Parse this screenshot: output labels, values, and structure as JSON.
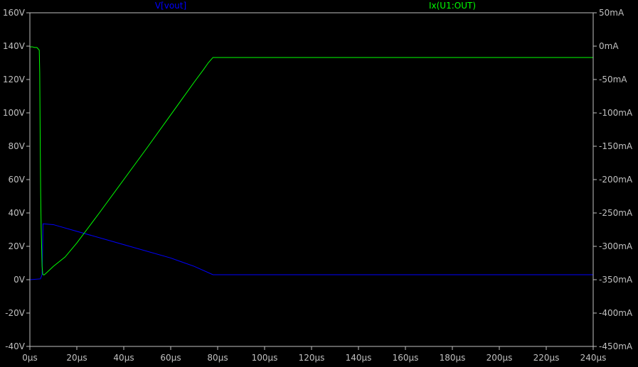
{
  "chart_data": {
    "type": "line",
    "title": "",
    "background": "#000000",
    "frame_color": "#c0c0c0",
    "grid": false,
    "x_axis": {
      "range_us": [
        0,
        240
      ],
      "tick_values_us": [
        0,
        20,
        40,
        60,
        80,
        100,
        120,
        140,
        160,
        180,
        200,
        220,
        240
      ],
      "tick_labels": [
        "0µs",
        "20µs",
        "40µs",
        "60µs",
        "80µs",
        "100µs",
        "120µs",
        "140µs",
        "160µs",
        "180µs",
        "200µs",
        "220µs",
        "240µs"
      ]
    },
    "left_axis": {
      "range_V": [
        -40,
        160
      ],
      "tick_values_V": [
        -40,
        -20,
        0,
        20,
        40,
        60,
        80,
        100,
        120,
        140,
        160
      ],
      "tick_labels": [
        "-40V",
        "-20V",
        "0V",
        "20V",
        "40V",
        "60V",
        "80V",
        "100V",
        "120V",
        "140V",
        "160V"
      ]
    },
    "right_axis": {
      "range_mA": [
        -450,
        50
      ],
      "tick_values_mA": [
        -450,
        -400,
        -350,
        -300,
        -250,
        -200,
        -150,
        -100,
        -50,
        0,
        50
      ],
      "tick_labels": [
        "-450mA",
        "-400mA",
        "-350mA",
        "-300mA",
        "-250mA",
        "-200mA",
        "-150mA",
        "-100mA",
        "-50mA",
        "0mA",
        "50mA"
      ]
    },
    "series": [
      {
        "name": "V[vout]",
        "color": "#0000ff",
        "axis": "left",
        "x": [
          0,
          4.5,
          5.2,
          5.6,
          10,
          20,
          40,
          60,
          70,
          78,
          80,
          120,
          160,
          200,
          240
        ],
        "y": [
          0,
          0.5,
          3,
          33.5,
          33,
          29,
          21,
          13,
          8,
          3,
          3,
          3,
          3,
          3,
          3
        ]
      },
      {
        "name": "Ix(U1:OUT)",
        "color": "#00ff00",
        "axis": "right",
        "x": [
          0,
          1,
          2,
          3,
          3.5,
          4,
          4.2,
          4.4,
          4.6,
          4.8,
          5,
          5.2,
          5.5,
          6,
          7,
          10,
          15,
          20,
          30,
          40,
          50,
          60,
          70,
          74,
          76,
          78,
          80,
          120,
          160,
          200,
          240
        ],
        "y": [
          -1,
          -1,
          -2,
          -2,
          -4,
          -6,
          -40,
          -140,
          -220,
          -270,
          -300,
          -330,
          -342,
          -343,
          -340,
          -330,
          -316,
          -295,
          -248,
          -200,
          -152,
          -103,
          -54,
          -35,
          -25,
          -17,
          -17,
          -17,
          -17,
          -17,
          -17
        ]
      }
    ]
  }
}
